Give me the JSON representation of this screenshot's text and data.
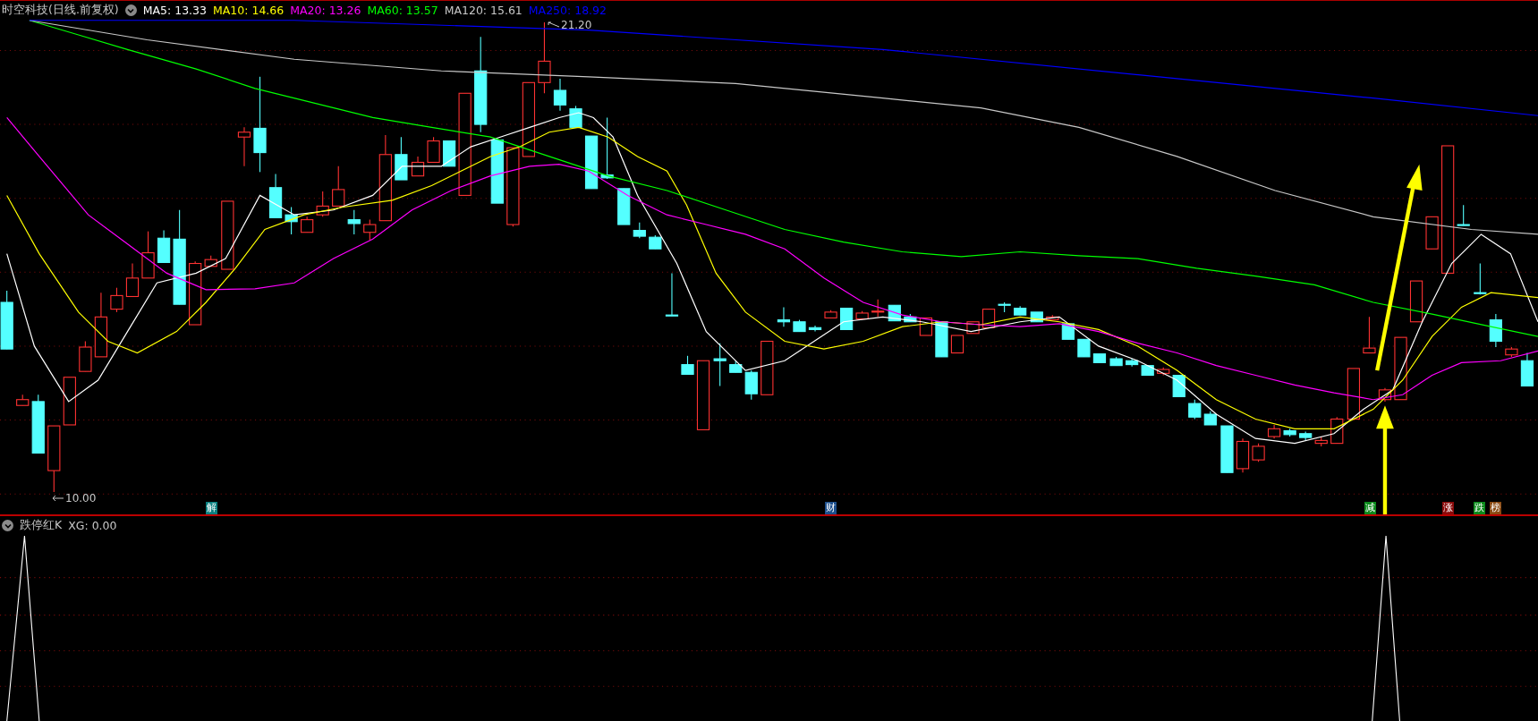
{
  "chart": {
    "title": "时空科技(日线.前复权)",
    "ma_legend": [
      {
        "label": "MA5: 13.33",
        "color": "#ffffff"
      },
      {
        "label": "MA10: 14.66",
        "color": "#ffff00"
      },
      {
        "label": "MA20: 13.26",
        "color": "#ff00ff"
      },
      {
        "label": "MA60: 13.57",
        "color": "#00ff00"
      },
      {
        "label": "MA120: 15.61",
        "color": "#c8c8c8"
      },
      {
        "label": "MA250: 18.92",
        "color": "#0000ff"
      }
    ],
    "high_marker": "21.20",
    "low_marker": "10.00",
    "event_badges": [
      {
        "text": "解",
        "color": "#0a7f7f"
      },
      {
        "text": "财",
        "color": "#1d4f8c"
      },
      {
        "text": "减",
        "color": "#0b8a1b"
      },
      {
        "text": "涨",
        "color": "#8a0a0a"
      },
      {
        "text": "跌",
        "color": "#0b8a1b"
      },
      {
        "text": "榜",
        "color": "#8a4a12"
      }
    ]
  },
  "indicator": {
    "title": "跌停红K",
    "value": "XG: 0.00"
  }
}
